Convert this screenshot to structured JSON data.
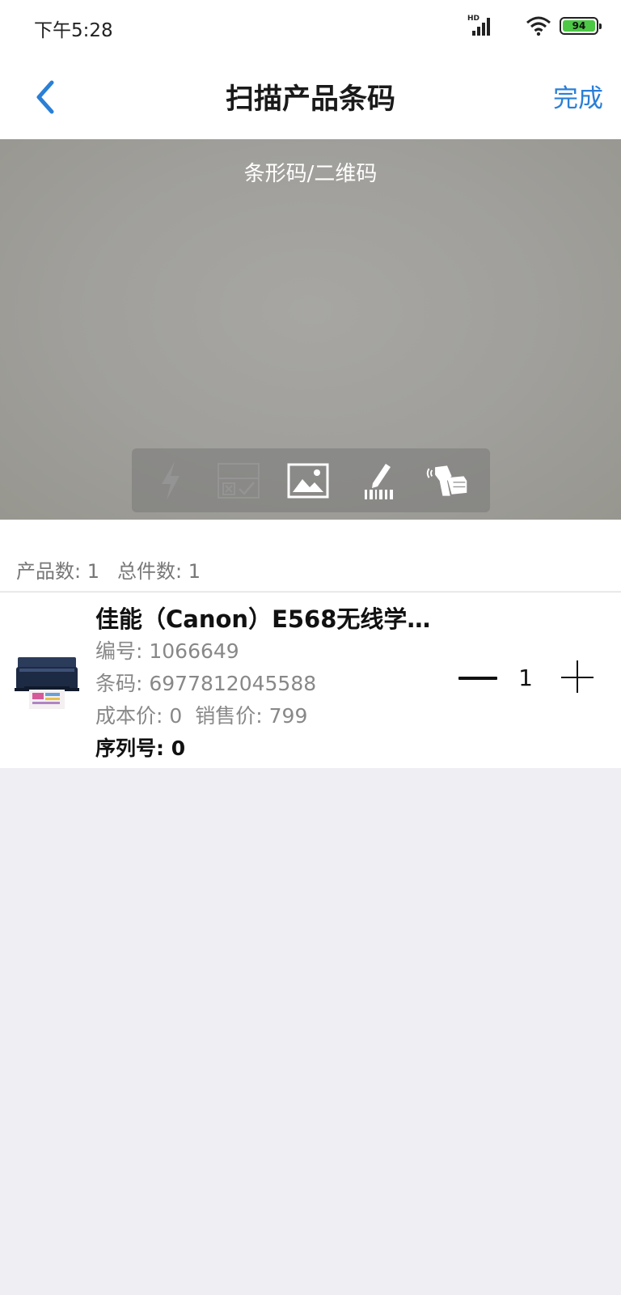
{
  "status_bar": {
    "time": "下午5:28",
    "network_label": "HD",
    "battery_level": "94",
    "battery_color": "#4cc845"
  },
  "nav": {
    "title": "扫描产品条码",
    "done_label": "完成",
    "back_icon": "chevron-left-icon",
    "accent_color": "#2a7fd6"
  },
  "scanner": {
    "hint": "条形码/二维码",
    "tools": [
      {
        "icon": "flash-icon",
        "enabled": false
      },
      {
        "icon": "batch-check-icon",
        "enabled": false
      },
      {
        "icon": "image-icon",
        "enabled": true
      },
      {
        "icon": "manual-input-icon",
        "enabled": true
      },
      {
        "icon": "handheld-scanner-icon",
        "enabled": true
      }
    ]
  },
  "summary": {
    "product_count": "产品数: 1",
    "total_count": "总件数: 1"
  },
  "products": [
    {
      "name": "佳能（Canon）E568无线学生...",
      "code": "编号: 1066649",
      "barcode": "条码: 6977812045588",
      "cost_price": "成本价: 0",
      "sale_price": "销售价: 799",
      "serial": "序列号: 0",
      "quantity": "1",
      "image_icon": "printer-image"
    }
  ]
}
